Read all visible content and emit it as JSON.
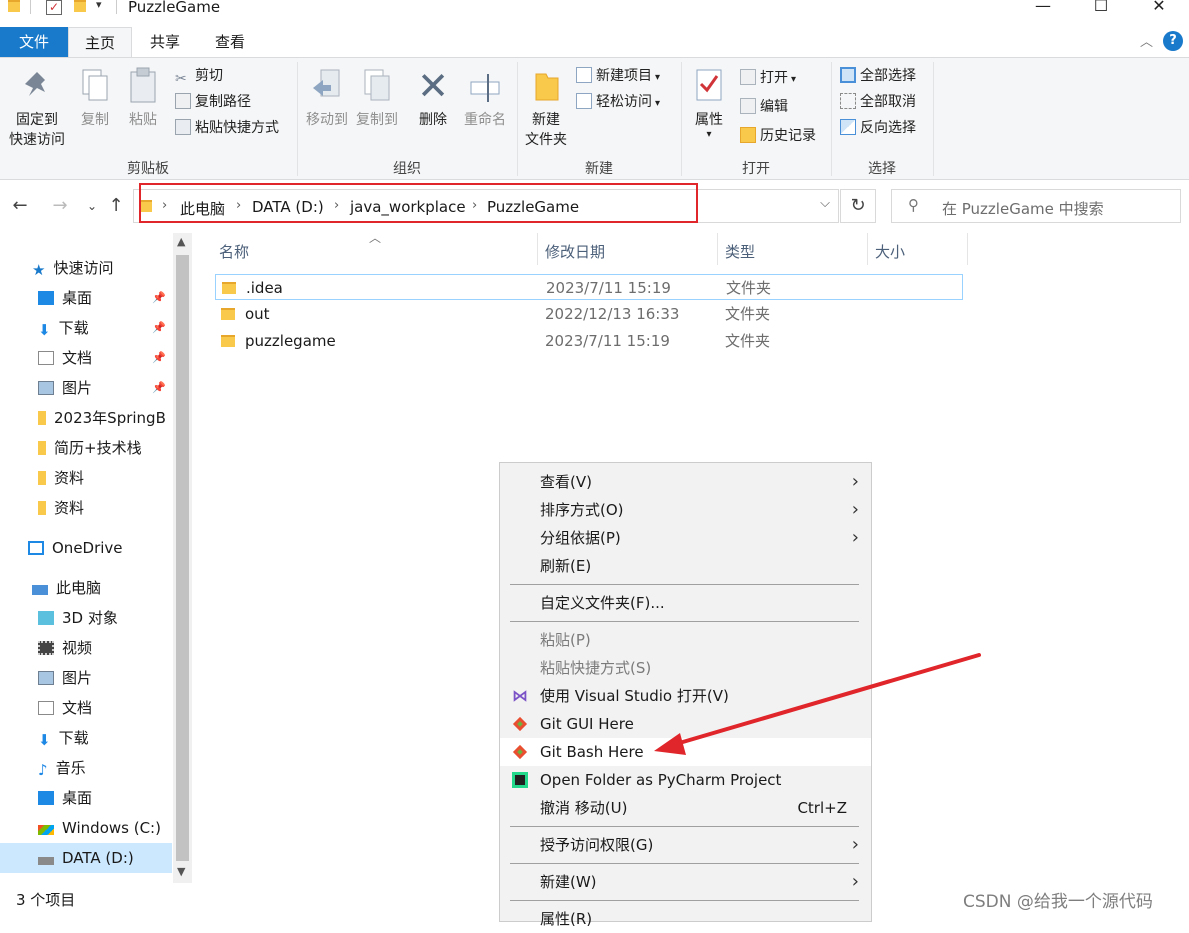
{
  "window": {
    "title": "PuzzleGame",
    "quick_access_toolbar": [
      "folder-icon",
      "checkbox-properties-icon",
      "new-folder-icon",
      "customize-dropdown-icon"
    ],
    "controls": [
      "minimize",
      "maximize",
      "close"
    ]
  },
  "ribbon_tabs": [
    "文件",
    "主页",
    "共享",
    "查看"
  ],
  "ribbon": {
    "clipboard": {
      "group_label": "剪贴板",
      "pin_label_line1": "固定到",
      "pin_label_line2": "快速访问",
      "copy_label": "复制",
      "paste_label": "粘贴",
      "cut_label": "剪切",
      "copy_path_label": "复制路径",
      "paste_shortcut_label": "粘贴快捷方式"
    },
    "organize": {
      "group_label": "组织",
      "move_to_label": "移动到",
      "copy_to_label": "复制到",
      "delete_label": "删除",
      "rename_label": "重命名"
    },
    "new": {
      "group_label": "新建",
      "new_folder_line1": "新建",
      "new_folder_line2": "文件夹",
      "new_item_label": "新建项目",
      "easy_access_label": "轻松访问"
    },
    "open": {
      "group_label": "打开",
      "properties_label": "属性",
      "open_label": "打开",
      "edit_label": "编辑",
      "history_label": "历史记录"
    },
    "select": {
      "group_label": "选择",
      "select_all_label": "全部选择",
      "select_none_label": "全部取消",
      "invert_label": "反向选择"
    }
  },
  "address_bar": {
    "crumbs": [
      "此电脑",
      "DATA (D:)",
      "java_workplace",
      "PuzzleGame"
    ],
    "search_placeholder": "在 PuzzleGame 中搜索"
  },
  "sidebar": {
    "quick_access": {
      "label": "快速访问",
      "items": [
        {
          "label": "桌面",
          "icon": "desktop-icon",
          "pinned": true
        },
        {
          "label": "下载",
          "icon": "download-icon",
          "pinned": true
        },
        {
          "label": "文档",
          "icon": "document-icon",
          "pinned": true
        },
        {
          "label": "图片",
          "icon": "picture-icon",
          "pinned": true
        },
        {
          "label": "2023年SpringB",
          "icon": "folder-icon",
          "pinned": false
        },
        {
          "label": "简历+技术栈",
          "icon": "folder-icon",
          "pinned": false
        },
        {
          "label": "资料",
          "icon": "folder-icon",
          "pinned": false
        },
        {
          "label": "资料",
          "icon": "folder-icon",
          "pinned": false
        }
      ]
    },
    "onedrive": {
      "label": "OneDrive"
    },
    "this_pc": {
      "label": "此电脑",
      "items": [
        {
          "label": "3D 对象",
          "icon": "cube-icon"
        },
        {
          "label": "视频",
          "icon": "video-icon"
        },
        {
          "label": "图片",
          "icon": "picture-icon"
        },
        {
          "label": "文档",
          "icon": "document-icon"
        },
        {
          "label": "下载",
          "icon": "download-icon"
        },
        {
          "label": "音乐",
          "icon": "music-icon"
        },
        {
          "label": "桌面",
          "icon": "desktop-icon"
        },
        {
          "label": "Windows (C:)",
          "icon": "drive-c-icon"
        },
        {
          "label": "DATA (D:)",
          "icon": "drive-icon",
          "selected": true
        }
      ]
    }
  },
  "file_list": {
    "columns": [
      "名称",
      "修改日期",
      "类型",
      "大小"
    ],
    "rows": [
      {
        "name": ".idea",
        "date": "2023/7/11 15:19",
        "type": "文件夹"
      },
      {
        "name": "out",
        "date": "2022/12/13 16:33",
        "type": "文件夹"
      },
      {
        "name": "puzzlegame",
        "date": "2023/7/11 15:19",
        "type": "文件夹"
      }
    ]
  },
  "context_menu": {
    "items": [
      {
        "label": "查看(V)",
        "submenu": true
      },
      {
        "label": "排序方式(O)",
        "submenu": true
      },
      {
        "label": "分组依据(P)",
        "submenu": true
      },
      {
        "label": "刷新(E)"
      },
      {
        "label": "自定义文件夹(F)..."
      },
      {
        "label": "粘贴(P)",
        "disabled": true
      },
      {
        "label": "粘贴快捷方式(S)",
        "disabled": true
      },
      {
        "label": "使用 Visual Studio 打开(V)",
        "icon": "visual-studio-icon"
      },
      {
        "label": "Git GUI Here",
        "icon": "git-icon"
      },
      {
        "label": "Git Bash Here",
        "icon": "git-icon",
        "highlighted": true
      },
      {
        "label": "Open Folder as PyCharm Project",
        "icon": "pycharm-icon"
      },
      {
        "label": "撤消 移动(U)",
        "shortcut": "Ctrl+Z"
      },
      {
        "label": "授予访问权限(G)",
        "submenu": true
      },
      {
        "label": "新建(W)",
        "submenu": true
      },
      {
        "label": "属性(R)"
      }
    ]
  },
  "status_bar": {
    "item_count": "3 个项目"
  },
  "watermark": "CSDN @给我一个源代码",
  "colors": {
    "accent": "#1979ca",
    "highlight_box": "#e0262b",
    "arrow": "#e0262b",
    "folder": "#f8c94a"
  }
}
